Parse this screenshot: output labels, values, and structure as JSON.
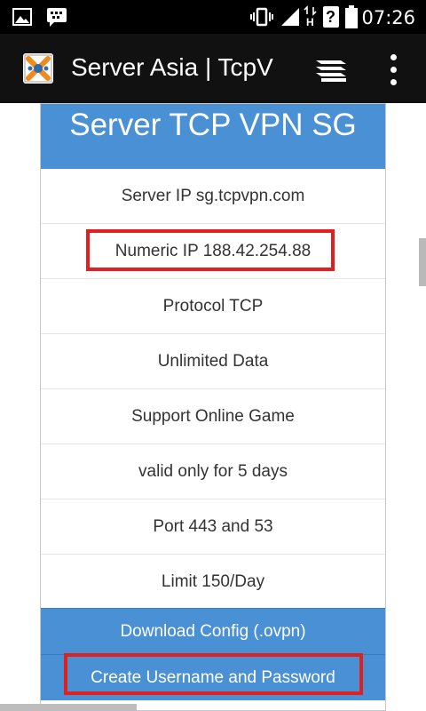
{
  "status_bar": {
    "time": "07:26",
    "icons": [
      "image-icon",
      "bbm-icon",
      "vibrate-icon",
      "signal-icon",
      "h-data-icon",
      "no-sim-icon",
      "battery-icon"
    ],
    "h_label": "H",
    "unknown_label": "?"
  },
  "app_bar": {
    "title": "Server Asia | TcpV",
    "logo_icon": "tcpvpn-logo-icon",
    "menu_icon": "stack-menu-icon",
    "overflow_icon": "overflow-menu-icon"
  },
  "card": {
    "header": "Server TCP VPN SG",
    "rows": [
      "Server IP sg.tcpvpn.com",
      "Numeric IP 188.42.254.88",
      "Protocol TCP",
      "Unlimited Data",
      "Support Online Game",
      "valid only for 5 days",
      "Port 443 and 53",
      "Limit 150/Day"
    ],
    "download_button": "Download Config (.ovpn)",
    "create_button": "Create Username and Password"
  },
  "colors": {
    "header_blue": "#4a90d4",
    "highlight_red": "#e02020",
    "app_bar": "#111111"
  }
}
